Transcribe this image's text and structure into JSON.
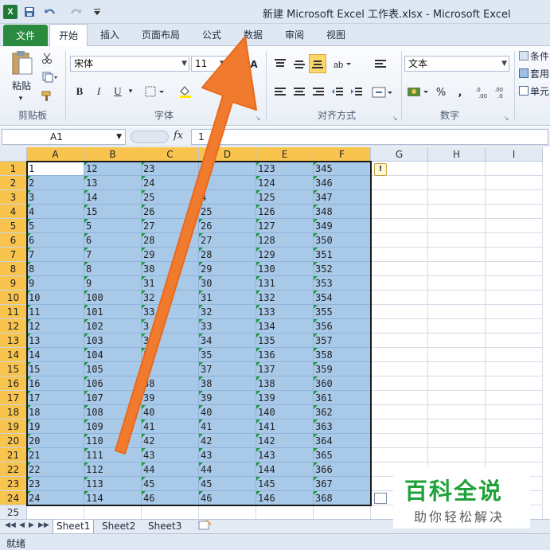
{
  "titlebar": {
    "app_icon": "X",
    "title": "新建 Microsoft Excel 工作表.xlsx - Microsoft Excel",
    "save_icon": "save-icon",
    "undo_icon": "undo-icon",
    "redo_icon": "redo-icon"
  },
  "tabs": [
    "文件",
    "开始",
    "插入",
    "页面布局",
    "公式",
    "数据",
    "审阅",
    "视图"
  ],
  "ribbon": {
    "clipboard": {
      "paste_label": "粘贴",
      "group_label": "剪贴板"
    },
    "font": {
      "font_name": "宋体",
      "font_size": "11",
      "bold": "B",
      "italic": "I",
      "underline": "U",
      "group_label": "字体"
    },
    "alignment": {
      "group_label": "对齐方式"
    },
    "number": {
      "format": "文本",
      "percent": "%",
      "group_label": "数字"
    },
    "styles": {
      "item1": "条件",
      "item2": "套用",
      "item3": "单元"
    }
  },
  "formula_bar": {
    "name_box": "A1",
    "fx_label": "fx",
    "formula": "1"
  },
  "columns": [
    "A",
    "B",
    "C",
    "D",
    "E",
    "F",
    "G",
    "H",
    "I"
  ],
  "rows": [
    [
      "1",
      "12",
      "23",
      "",
      "123",
      "345"
    ],
    [
      "2",
      "13",
      "24",
      "",
      "124",
      "346"
    ],
    [
      "3",
      "14",
      "25",
      "4",
      "125",
      "347"
    ],
    [
      "4",
      "15",
      "26",
      "25",
      "126",
      "348"
    ],
    [
      "5",
      "5",
      "27",
      "26",
      "127",
      "349"
    ],
    [
      "6",
      "6",
      "28",
      "27",
      "128",
      "350"
    ],
    [
      "7",
      "7",
      "29",
      "28",
      "129",
      "351"
    ],
    [
      "8",
      "8",
      "30",
      "29",
      "130",
      "352"
    ],
    [
      "9",
      "9",
      "31",
      "30",
      "131",
      "353"
    ],
    [
      "10",
      "100",
      "32",
      "31",
      "132",
      "354"
    ],
    [
      "11",
      "101",
      "33",
      "32",
      "133",
      "355"
    ],
    [
      "12",
      "102",
      "3",
      "33",
      "134",
      "356"
    ],
    [
      "13",
      "103",
      "3",
      "34",
      "135",
      "357"
    ],
    [
      "14",
      "104",
      "3",
      "35",
      "136",
      "358"
    ],
    [
      "15",
      "105",
      "7",
      "37",
      "137",
      "359"
    ],
    [
      "16",
      "106",
      "38",
      "38",
      "138",
      "360"
    ],
    [
      "17",
      "107",
      "39",
      "39",
      "139",
      "361"
    ],
    [
      "18",
      "108",
      "40",
      "40",
      "140",
      "362"
    ],
    [
      "19",
      "109",
      "41",
      "41",
      "141",
      "363"
    ],
    [
      "20",
      "110",
      "42",
      "42",
      "142",
      "364"
    ],
    [
      "21",
      "111",
      "43",
      "43",
      "143",
      "365"
    ],
    [
      "22",
      "112",
      "44",
      "44",
      "144",
      "366"
    ],
    [
      "23",
      "113",
      "45",
      "45",
      "145",
      "367"
    ],
    [
      "24",
      "114",
      "46",
      "46",
      "146",
      "368"
    ]
  ],
  "extra_row": "25",
  "sheets": [
    "Sheet1",
    "Sheet2",
    "Sheet3"
  ],
  "status": "就绪",
  "watermark": {
    "main": "百科全说",
    "sub": "助你轻松解决"
  },
  "colors": {
    "accent_green": "#2a8a3e",
    "selection": "#a9c9e8",
    "header_highlight": "#f8c44e",
    "arrow": "#f07a2e"
  }
}
